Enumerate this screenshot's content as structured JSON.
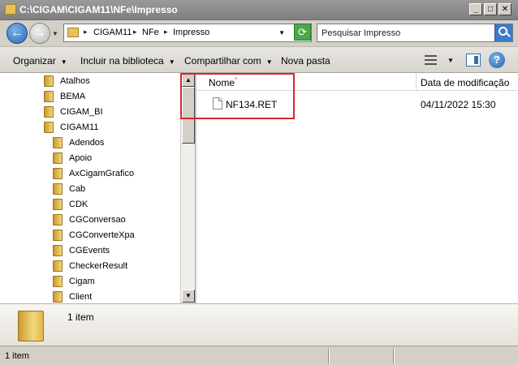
{
  "window": {
    "title": "C:\\CIGAM\\CIGAM11\\NFe\\Impresso",
    "minimize": "_",
    "maximize": "□",
    "close": "✕"
  },
  "address": {
    "crumbs": [
      "CIGAM11",
      "NFe",
      "Impresso"
    ],
    "search_placeholder": "Pesquisar Impresso"
  },
  "toolbar": {
    "organize": "Organizar",
    "include_library": "Incluir na biblioteca",
    "share": "Compartilhar com",
    "new_folder": "Nova pasta"
  },
  "nav": {
    "items": [
      {
        "label": "Atalhos",
        "level": 0
      },
      {
        "label": "BEMA",
        "level": 0
      },
      {
        "label": "CIGAM_BI",
        "level": 0
      },
      {
        "label": "CIGAM11",
        "level": 0
      },
      {
        "label": "Adendos",
        "level": 1
      },
      {
        "label": "Apoio",
        "level": 1
      },
      {
        "label": "AxCigamGrafico",
        "level": 1
      },
      {
        "label": "Cab",
        "level": 1
      },
      {
        "label": "CDK",
        "level": 1
      },
      {
        "label": "CGConversao",
        "level": 1
      },
      {
        "label": "CGConverteXpa",
        "level": 1
      },
      {
        "label": "CGEvents",
        "level": 1
      },
      {
        "label": "CheckerResult",
        "level": 1
      },
      {
        "label": "Cigam",
        "level": 1
      },
      {
        "label": "Client",
        "level": 1
      }
    ]
  },
  "columns": {
    "name": "Nome",
    "modified": "Data de modificação"
  },
  "files": [
    {
      "name": "NF134.RET",
      "modified": "04/11/2022 15:30"
    }
  ],
  "details": {
    "count_text": "1 item"
  },
  "status": {
    "text": "1 item"
  },
  "colors": {
    "highlight": "#d9262b",
    "folder": "#e8c259"
  }
}
